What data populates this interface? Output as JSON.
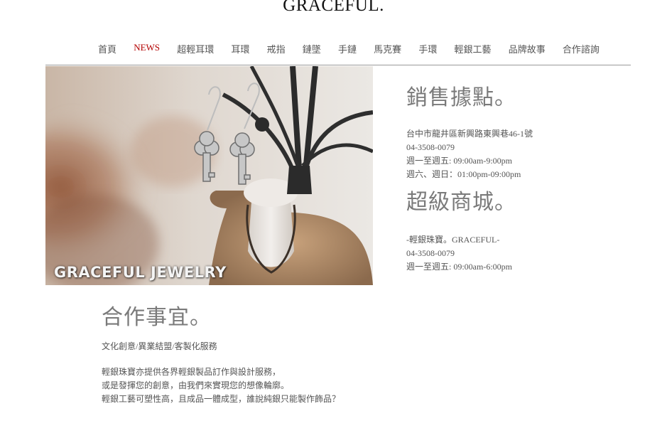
{
  "site": {
    "title": "GRACEFUL."
  },
  "nav": {
    "items": [
      {
        "label": "首頁"
      },
      {
        "label": "NEWS"
      },
      {
        "label": "超輕耳環"
      },
      {
        "label": "耳環"
      },
      {
        "label": "戒指"
      },
      {
        "label": "鏈墜"
      },
      {
        "label": "手鏈"
      },
      {
        "label": "馬克賽"
      },
      {
        "label": "手環"
      },
      {
        "label": "輕銀工藝"
      },
      {
        "label": "品牌故事"
      },
      {
        "label": "合作諮詢"
      }
    ],
    "active_index": 1,
    "active_color": "#b30000"
  },
  "hero": {
    "caption": "GRACEFUL JEWELRY"
  },
  "store": {
    "title": "銷售據點。",
    "lines": [
      "台中市龍井區新興路東興巷46-1號",
      "04-3508-0079",
      "週一至週五: 09:00am-9:00pm",
      "週六、週日：01:00pm-09:00pm"
    ]
  },
  "mall": {
    "title": "超級商城。",
    "lines": [
      "-輕銀珠寶。GRACEFUL-",
      "04-3508-0079",
      "週一至週五: 09:00am-6:00pm"
    ]
  },
  "coop": {
    "title": "合作事宜。",
    "subtitle": "文化創意/異業結盟/客製化服務",
    "lines": [
      "輕銀珠寶亦提供各界輕銀製品訂作與設計服務，",
      "或是發揮您的創意，由我們來實現您的想像輪廓。",
      "輕銀工藝可塑性高，且成品一體成型，誰說純銀只能製作飾品？"
    ]
  }
}
